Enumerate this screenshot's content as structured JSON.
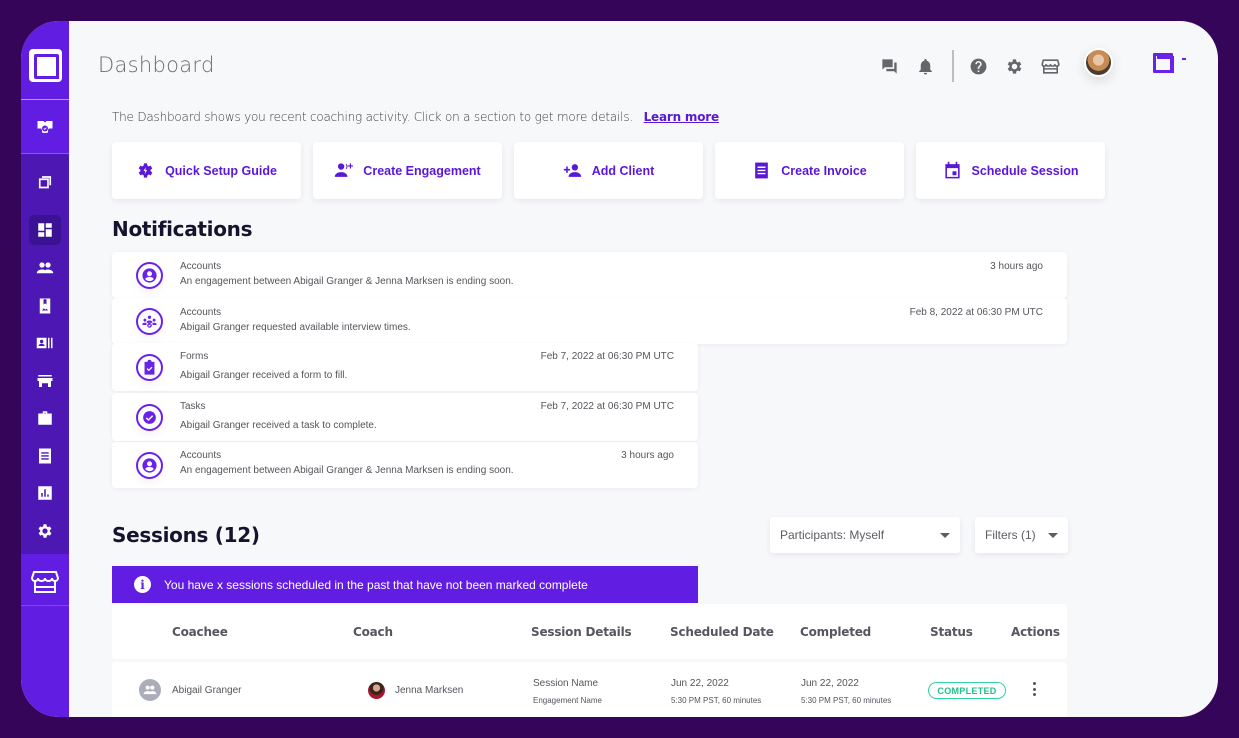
{
  "header": {
    "title": "Dashboard",
    "icons": [
      "chat-icon",
      "bell-icon",
      "help-icon",
      "settings-icon",
      "store-icon"
    ]
  },
  "sidebar": {
    "items": [
      {
        "name": "certificate-icon"
      },
      {
        "name": "brand-icon"
      },
      {
        "name": "dashboard-icon",
        "active": true
      },
      {
        "name": "people-icon"
      },
      {
        "name": "contacts-book-icon"
      },
      {
        "name": "id-card-icon"
      },
      {
        "name": "storefront-icon"
      },
      {
        "name": "briefcase-icon"
      },
      {
        "name": "invoice-icon"
      },
      {
        "name": "reports-icon"
      },
      {
        "name": "settings-icon"
      }
    ],
    "bottom": "store-icon"
  },
  "intro": {
    "text": "The Dashboard shows you recent coaching activity. Click on  a section to get more details.",
    "link": "Learn more"
  },
  "quick_actions": [
    {
      "label": "Quick Setup Guide",
      "icon": "gear-bolt-icon"
    },
    {
      "label": "Create Engagement",
      "icon": "add-group-icon"
    },
    {
      "label": "Add Client",
      "icon": "add-person-icon"
    },
    {
      "label": "Create Invoice",
      "icon": "receipt-icon"
    },
    {
      "label": "Schedule Session",
      "icon": "calendar-icon"
    }
  ],
  "notifications": {
    "title": "Notifications",
    "items": [
      {
        "category": "Accounts",
        "message": "An engagement between Abigail Granger & Jenna Marksen is ending soon.",
        "time": "3 hours ago",
        "icon": "account-circle-icon"
      },
      {
        "category": "Accounts",
        "message": "Abigail Granger requested available interview times.",
        "time": "Feb 8, 2022 at 06:30 PM UTC",
        "icon": "group-check-icon"
      },
      {
        "category": "Forms",
        "message": "Abigail Granger received a form to fill.",
        "time": "Feb 7, 2022 at 06:30 PM UTC",
        "icon": "clipboard-check-icon"
      },
      {
        "category": "Tasks",
        "message": "Abigail Granger received a task to complete.",
        "time": "Feb 7, 2022 at 06:30 PM UTC",
        "icon": "check-circle-icon"
      },
      {
        "category": "Accounts",
        "message": "An engagement between Abigail Granger & Jenna Marksen is ending soon.",
        "time": "3 hours ago",
        "icon": "account-circle-icon"
      }
    ]
  },
  "sessions": {
    "title": "Sessions (12)",
    "participants_filter": "Participants: Myself",
    "filters": "Filters (1)",
    "alert": "You have x sessions scheduled in the past that have not been marked complete",
    "columns": [
      "Coachee",
      "Coach",
      "Session Details",
      "Scheduled Date",
      "Completed",
      "Status",
      "Actions"
    ],
    "rows": [
      {
        "coachee": "Abigail Granger",
        "coach": "Jenna Marksen",
        "session_name": "Session Name",
        "engagement_name": "Engagement Name",
        "scheduled_date": "Jun 22, 2022",
        "scheduled_time": "5:30 PM PST, 60 minutes",
        "completed_date": "Jun 22, 2022",
        "completed_time": "5:30 PM PST, 60 minutes",
        "status": "COMPLETED"
      }
    ]
  },
  "colors": {
    "brand": "#621DE3",
    "sidebar_dark": "#4C17B3",
    "accent_text": "#5A17D6",
    "success": "#2FD59C",
    "outer_frame": "#340558"
  }
}
